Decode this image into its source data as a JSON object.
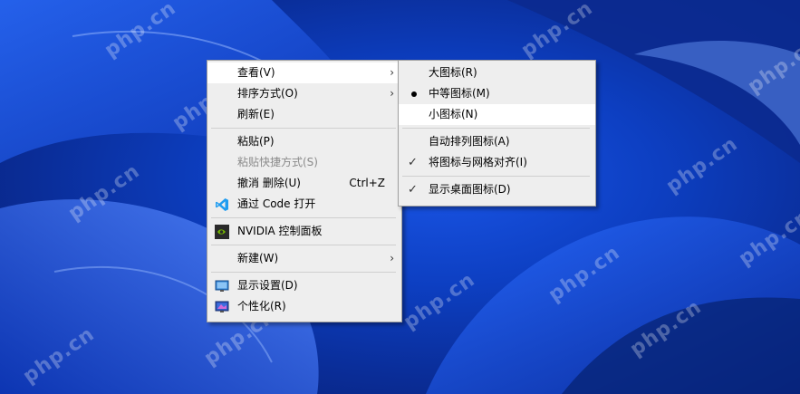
{
  "watermark": "php.cn",
  "context_menu": {
    "items": [
      {
        "label": "查看(V)"
      },
      {
        "label": "排序方式(O)"
      },
      {
        "label": "刷新(E)"
      },
      {
        "label": "粘贴(P)"
      },
      {
        "label": "粘贴快捷方式(S)"
      },
      {
        "label": "撤消 删除(U)",
        "shortcut": "Ctrl+Z"
      },
      {
        "label": "通过 Code 打开"
      },
      {
        "label": "NVIDIA 控制面板"
      },
      {
        "label": "新建(W)"
      },
      {
        "label": "显示设置(D)"
      },
      {
        "label": "个性化(R)"
      }
    ]
  },
  "view_submenu": {
    "items": [
      {
        "label": "大图标(R)"
      },
      {
        "label": "中等图标(M)",
        "selected": true
      },
      {
        "label": "小图标(N)"
      },
      {
        "label": "自动排列图标(A)"
      },
      {
        "label": "将图标与网格对齐(I)",
        "checked": true
      },
      {
        "label": "显示桌面图标(D)",
        "checked": true
      }
    ]
  },
  "icons": {
    "submenu_arrow": "chevron-right-icon",
    "vscode": "vscode-icon",
    "nvidia": "nvidia-icon",
    "display": "display-settings-icon",
    "personalize": "personalize-icon",
    "check": "checkmark-icon",
    "bullet": "radio-bullet-icon"
  }
}
